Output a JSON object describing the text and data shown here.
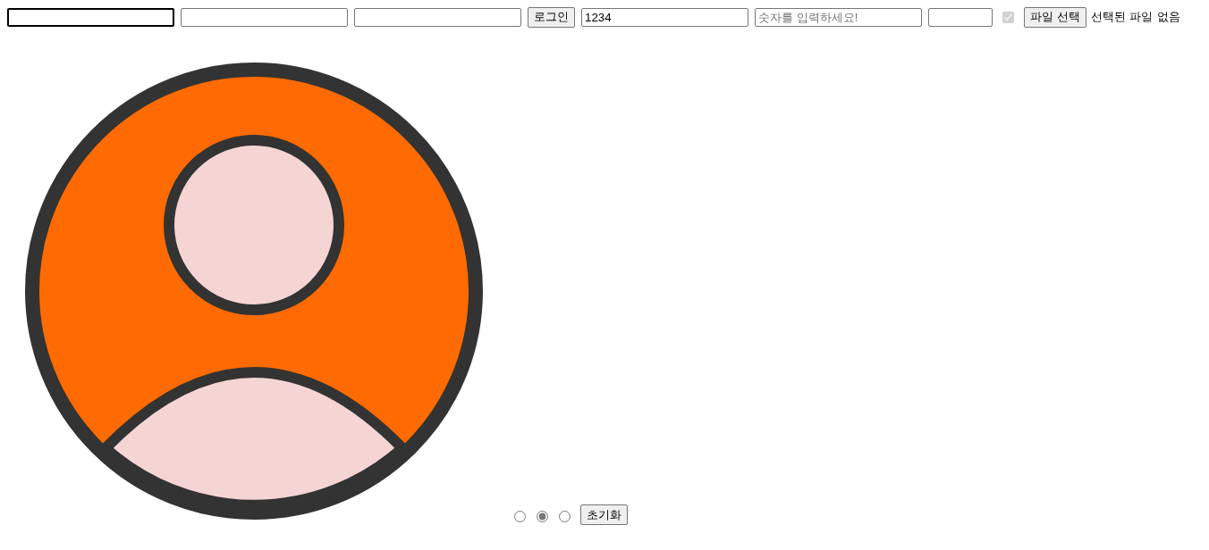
{
  "top_row": [
    {
      "kind": "input",
      "focused": true
    },
    {
      "kind": "input",
      "focused": false
    },
    {
      "kind": "input",
      "focused": false
    },
    {
      "kind": "button",
      "label": "로그인"
    },
    {
      "kind": "input",
      "focused": false,
      "value": "1234"
    },
    {
      "kind": "input",
      "focused": false,
      "placeholder": "숫자를 입력하세요!"
    },
    {
      "kind": "short-input",
      "focused": false
    },
    {
      "kind": "checkbox",
      "checked": true,
      "disabled": true
    },
    {
      "kind": "file",
      "button": "파일 선택",
      "status": "선택된 파일 없음"
    }
  ],
  "radios": [
    {
      "selected": false
    },
    {
      "selected": true
    },
    {
      "selected": false
    }
  ],
  "reset_button": "초기화"
}
